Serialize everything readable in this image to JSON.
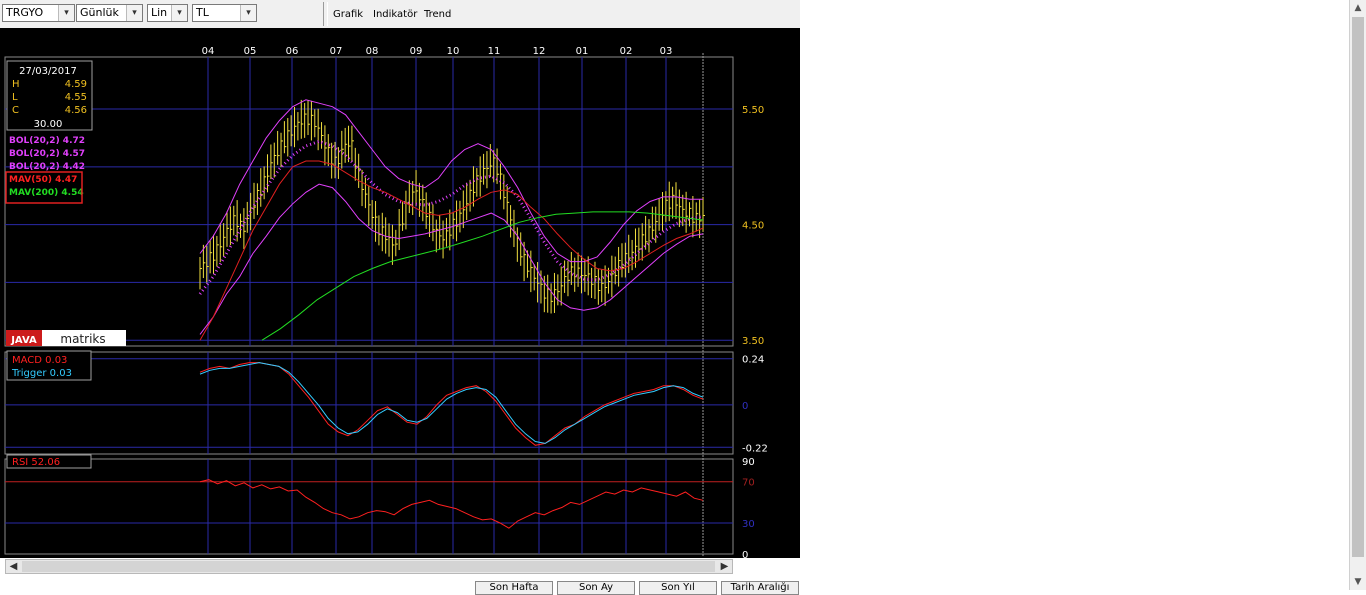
{
  "toolbar": {
    "symbol": "TRGYO",
    "period": "Günlük",
    "scale": "Lin",
    "currency": "TL",
    "menu": [
      "Grafik",
      "Indikatör",
      "Trend"
    ],
    "arrow": "▾"
  },
  "chart_data": [
    {
      "type": "line",
      "title": "",
      "x_ticks": [
        "04",
        "05",
        "06",
        "07",
        "08",
        "09",
        "10",
        "11",
        "12",
        "01",
        "02",
        "03"
      ],
      "y_ticks": [
        "5.50",
        "4.50",
        "3.50"
      ],
      "ylim": [
        3.45,
        5.95
      ],
      "grid": true,
      "info_box": {
        "date": "27/03/2017",
        "h_label": "H",
        "h": "4.59",
        "l_label": "L",
        "l": "4.55",
        "c_label": "C",
        "c": "4.56",
        "vol": "30.00"
      },
      "legend": [
        {
          "name": "BOL(20,2)",
          "value": "4.72",
          "color": "#e040fb"
        },
        {
          "name": "BOL(20,2)",
          "value": "4.57",
          "color": "#e040fb"
        },
        {
          "name": "BOL(20,2)",
          "value": "4.42",
          "color": "#e040fb"
        },
        {
          "name": "MAV(50)",
          "value": "4.47",
          "color": "#ff2020"
        },
        {
          "name": "MAV(200)",
          "value": "4.54",
          "color": "#22dd22"
        }
      ],
      "price_close": [
        4.12,
        4.18,
        4.25,
        4.35,
        4.48,
        4.55,
        4.45,
        4.62,
        4.75,
        4.88,
        5.05,
        5.15,
        5.25,
        5.33,
        5.4,
        5.42,
        5.38,
        5.25,
        5.1,
        5.02,
        5.18,
        5.22,
        4.95,
        4.75,
        4.58,
        4.45,
        4.4,
        4.3,
        4.52,
        4.7,
        4.8,
        4.68,
        4.55,
        4.42,
        4.38,
        4.48,
        4.55,
        4.68,
        4.82,
        4.92,
        5.0,
        5.05,
        4.85,
        4.6,
        4.38,
        4.2,
        4.1,
        4.0,
        3.9,
        3.88,
        3.95,
        4.05,
        4.1,
        4.08,
        4.05,
        4.0,
        3.95,
        4.02,
        4.12,
        4.2,
        4.25,
        4.32,
        4.4,
        4.48,
        4.58,
        4.68,
        4.72,
        4.62,
        4.6,
        4.55,
        4.57
      ],
      "bol_upper": [
        4.25,
        4.4,
        4.6,
        4.85,
        5.05,
        5.25,
        5.4,
        5.52,
        5.58,
        5.55,
        5.52,
        5.45,
        5.3,
        5.15,
        5.0,
        4.9,
        4.85,
        4.82,
        4.9,
        5.05,
        5.15,
        5.2,
        5.15,
        5.0,
        4.82,
        4.6,
        4.4,
        4.25,
        4.18,
        4.18,
        4.22,
        4.35,
        4.5,
        4.62,
        4.7,
        4.74,
        4.74,
        4.72,
        4.72
      ],
      "bol_mid": [
        3.9,
        4.05,
        4.25,
        4.45,
        4.65,
        4.82,
        4.98,
        5.1,
        5.18,
        5.22,
        5.18,
        5.1,
        4.98,
        4.86,
        4.76,
        4.7,
        4.68,
        4.67,
        4.7,
        4.76,
        4.84,
        4.9,
        4.92,
        4.86,
        4.74,
        4.55,
        4.35,
        4.18,
        4.08,
        4.03,
        4.02,
        4.07,
        4.15,
        4.25,
        4.35,
        4.44,
        4.51,
        4.55,
        4.57
      ],
      "bol_lower": [
        3.55,
        3.7,
        3.9,
        4.05,
        4.25,
        4.4,
        4.56,
        4.68,
        4.78,
        4.85,
        4.82,
        4.7,
        4.55,
        4.45,
        4.4,
        4.38,
        4.4,
        4.42,
        4.45,
        4.48,
        4.52,
        4.56,
        4.6,
        4.54,
        4.4,
        4.2,
        4.0,
        3.85,
        3.78,
        3.76,
        3.78,
        3.85,
        3.95,
        4.05,
        4.15,
        4.25,
        4.33,
        4.4,
        4.42
      ],
      "mav50": [
        3.5,
        3.7,
        3.95,
        4.2,
        4.45,
        4.65,
        4.85,
        5.0,
        5.05,
        5.05,
        5.02,
        4.95,
        4.88,
        4.82,
        4.78,
        4.72,
        4.66,
        4.6,
        4.58,
        4.6,
        4.65,
        4.72,
        4.78,
        4.8,
        4.76,
        4.65,
        4.55,
        4.42,
        4.3,
        4.2,
        4.12,
        4.1,
        4.12,
        4.18,
        4.25,
        4.32,
        4.38,
        4.42,
        4.47
      ],
      "mav200": [
        3.5,
        3.6,
        3.72,
        3.85,
        3.95,
        4.05,
        4.12,
        4.18,
        4.22,
        4.26,
        4.3,
        4.35,
        4.4,
        4.46,
        4.52,
        4.56,
        4.59,
        4.6,
        4.61,
        4.61,
        4.61,
        4.6,
        4.58,
        4.56,
        4.54
      ]
    },
    {
      "type": "line",
      "title": "",
      "y_ticks": [
        "0.24",
        "0",
        "-0.22"
      ],
      "ylim": [
        -0.255,
        0.275
      ],
      "grid": true,
      "legend": [
        {
          "name": "MACD",
          "value": "0.03",
          "color": "#ff2020"
        },
        {
          "name": "Trigger",
          "value": "0.03",
          "color": "#33ccff"
        }
      ],
      "macd": [
        0.17,
        0.19,
        0.2,
        0.19,
        0.21,
        0.22,
        0.22,
        0.21,
        0.2,
        0.16,
        0.1,
        0.04,
        -0.03,
        -0.1,
        -0.14,
        -0.16,
        -0.13,
        -0.08,
        -0.03,
        -0.01,
        -0.05,
        -0.09,
        -0.1,
        -0.06,
        0.0,
        0.05,
        0.07,
        0.09,
        0.1,
        0.07,
        0.02,
        -0.05,
        -0.12,
        -0.17,
        -0.21,
        -0.2,
        -0.16,
        -0.12,
        -0.1,
        -0.06,
        -0.03,
        0.0,
        0.02,
        0.04,
        0.06,
        0.07,
        0.08,
        0.1,
        0.1,
        0.08,
        0.05,
        0.03
      ],
      "trigger": [
        0.16,
        0.18,
        0.19,
        0.19,
        0.2,
        0.21,
        0.22,
        0.21,
        0.2,
        0.17,
        0.12,
        0.06,
        0.0,
        -0.07,
        -0.12,
        -0.15,
        -0.14,
        -0.1,
        -0.05,
        -0.02,
        -0.04,
        -0.08,
        -0.09,
        -0.07,
        -0.02,
        0.03,
        0.06,
        0.08,
        0.09,
        0.08,
        0.04,
        -0.03,
        -0.1,
        -0.15,
        -0.19,
        -0.2,
        -0.17,
        -0.13,
        -0.1,
        -0.07,
        -0.04,
        -0.01,
        0.01,
        0.03,
        0.05,
        0.06,
        0.07,
        0.09,
        0.1,
        0.09,
        0.06,
        0.04
      ]
    },
    {
      "type": "line",
      "title": "",
      "y_ticks": [
        "90",
        "70",
        "30",
        "0"
      ],
      "ylim": [
        0,
        92
      ],
      "grid": true,
      "legend": [
        {
          "name": "RSI",
          "value": "52.06",
          "color": "#ff2020"
        }
      ],
      "rsi": [
        70,
        72,
        68,
        71,
        66,
        69,
        64,
        67,
        63,
        65,
        61,
        62,
        55,
        50,
        44,
        40,
        38,
        34,
        36,
        40,
        42,
        41,
        38,
        44,
        48,
        50,
        52,
        48,
        46,
        44,
        40,
        36,
        33,
        34,
        30,
        25,
        32,
        36,
        40,
        38,
        42,
        45,
        50,
        48,
        52,
        56,
        60,
        58,
        62,
        60,
        64,
        62,
        60,
        58,
        56,
        60,
        54,
        52
      ]
    }
  ],
  "logo": {
    "java": "JAVA",
    "matriks": "matriks"
  },
  "bottom_buttons": [
    "Son Hafta",
    "Son Ay",
    "Son Yıl",
    "Tarih Aralığı"
  ],
  "scroll": {
    "left": "◀",
    "right": "▶",
    "up": "▲",
    "down": "▼"
  }
}
